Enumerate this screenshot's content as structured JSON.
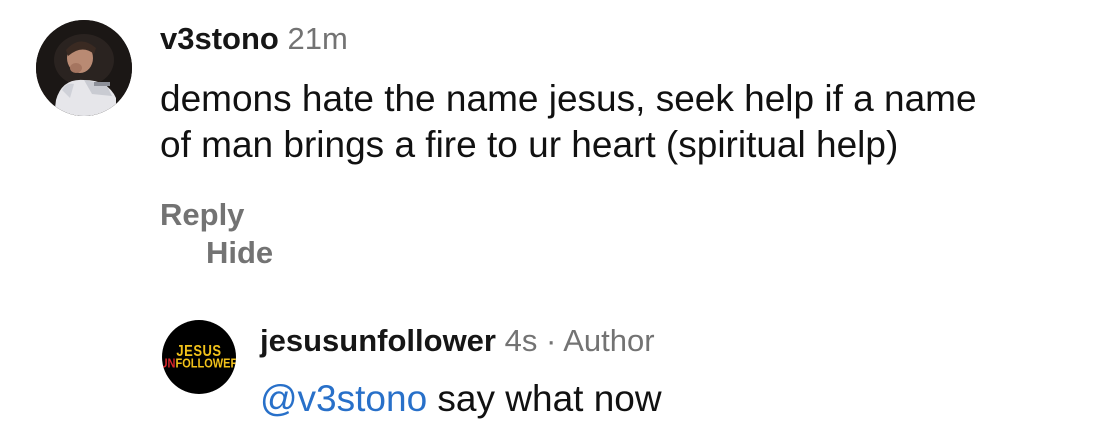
{
  "comment": {
    "username": "v3stono",
    "time": "21m",
    "text_line1": "demons hate the name jesus, seek help if a name",
    "text_line2": "of man brings a fire to ur heart (spiritual help)",
    "actions": {
      "reply_label": "Reply",
      "hide_label": "Hide"
    },
    "avatar_icon": "profile-photo"
  },
  "reply": {
    "username": "jesusunfollower",
    "time": "4s",
    "separator": "·",
    "author_tag": "Author",
    "mention": "@v3stono",
    "text": " say what now",
    "avatar_logo": {
      "line1": "JESUS",
      "line2_part1": "UN",
      "line2_part2": "FOLLOWER"
    }
  },
  "colors": {
    "mention": "#2870c9",
    "secondary_text": "#737373",
    "logo_yellow": "#f2c21a",
    "logo_red": "#d8262b"
  }
}
